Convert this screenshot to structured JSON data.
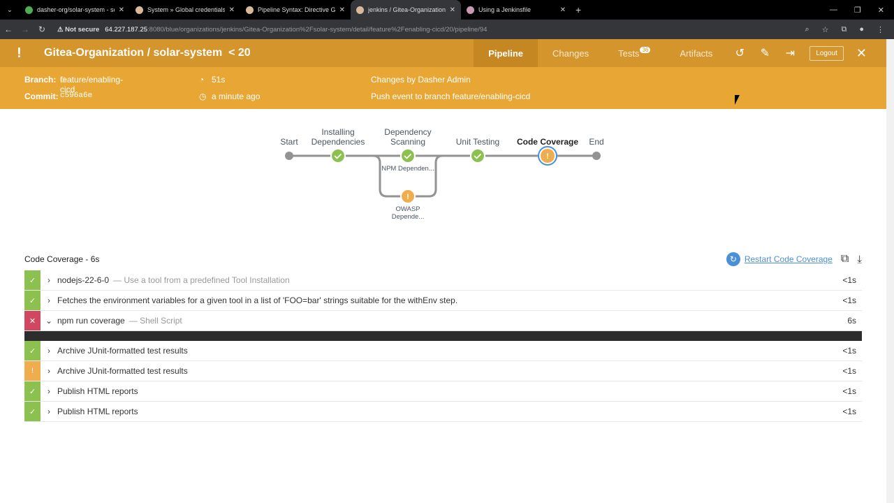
{
  "browser": {
    "tabs": [
      {
        "title": "dasher-org/solar-system - solar"
      },
      {
        "title": "System » Global credentials (un"
      },
      {
        "title": "Pipeline Syntax: Directive Gene"
      },
      {
        "title": "jenkins / Gitea-Organization/so",
        "active": true
      },
      {
        "title": "Using a Jenkinsfile"
      }
    ],
    "not_secure": "Not secure",
    "url_host": "64.227.187.25",
    "url_rest": ":8080/blue/organizations/jenkins/Gitea-Organization%2Fsolar-system/detail/feature%2Fenabling-cicd/20/pipeline/94"
  },
  "header": {
    "title": "Gitea-Organization / solar-system",
    "run_prefix": "<",
    "run": "20",
    "tabs": {
      "pipeline": "Pipeline",
      "changes": "Changes",
      "tests": "Tests",
      "tests_count": "36",
      "artifacts": "Artifacts"
    },
    "logout": "Logout"
  },
  "info": {
    "branch_label": "Branch:",
    "branch": "feature/enabling-cicd",
    "commit_label": "Commit:",
    "commit": "c596a6e",
    "duration": "51s",
    "time": "a minute ago",
    "changes": "Changes by Dasher Admin",
    "cause": "Push event to branch feature/enabling-cicd"
  },
  "graph": {
    "start": "Start",
    "stages": [
      "Installing Dependencies",
      "Dependency Scanning",
      "Unit Testing",
      "Code Coverage"
    ],
    "end": "End",
    "parallel": [
      "NPM Dependen...",
      "OWASP Depende..."
    ]
  },
  "steps": {
    "title": "Code Coverage - 6s",
    "restart": "Restart Code Coverage",
    "rows": [
      {
        "status": "ok",
        "name": "nodejs-22-6-0",
        "desc": "— Use a tool from a predefined Tool Installation",
        "dur": "<1s"
      },
      {
        "status": "ok",
        "name": "Fetches the environment variables for a given tool in a list of 'FOO=bar' strings suitable for the withEnv step.",
        "desc": "",
        "dur": "<1s"
      },
      {
        "status": "fail",
        "name": "npm run coverage",
        "desc": "— Shell Script",
        "dur": "6s"
      },
      {
        "status": "ok",
        "name": "Archive JUnit-formatted test results",
        "desc": "",
        "dur": "<1s"
      },
      {
        "status": "warn",
        "name": "Archive JUnit-formatted test results",
        "desc": "",
        "dur": "<1s"
      },
      {
        "status": "ok",
        "name": "Publish HTML reports",
        "desc": "",
        "dur": "<1s"
      },
      {
        "status": "ok",
        "name": "Publish HTML reports",
        "desc": "",
        "dur": "<1s"
      }
    ]
  },
  "colors": {
    "header": "#d4952c",
    "info": "#e8a735",
    "success": "#8cc04f",
    "failure": "#d24760",
    "unstable": "#f0ad4e"
  }
}
